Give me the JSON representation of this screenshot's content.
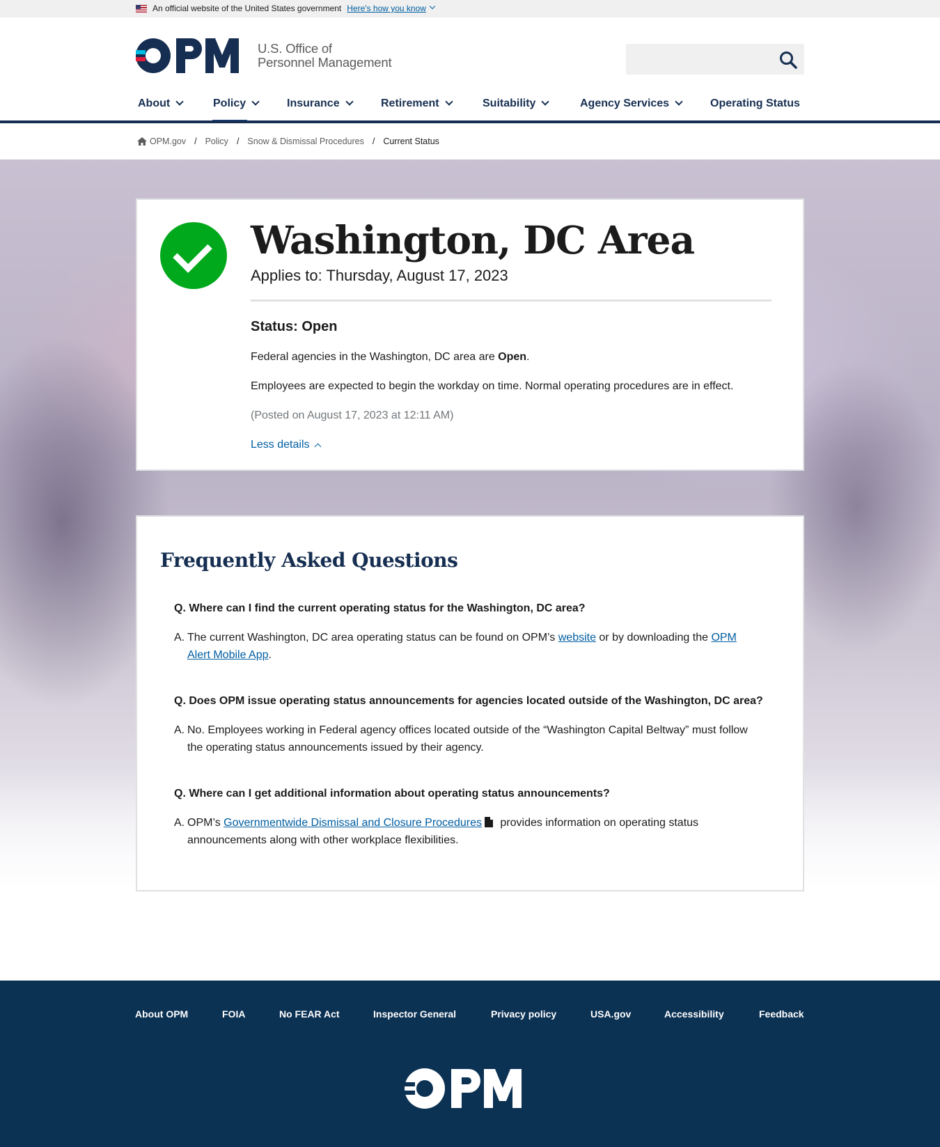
{
  "banner": {
    "text": "An official website of the United States government",
    "link": "Here's how you know"
  },
  "header": {
    "logo_text": "OPM",
    "org_line1": "U.S. Office of",
    "org_line2": "Personnel Management",
    "search_placeholder": ""
  },
  "nav": {
    "items": [
      {
        "label": "About",
        "dropdown": true
      },
      {
        "label": "Policy",
        "dropdown": true,
        "active": true
      },
      {
        "label": "Insurance",
        "dropdown": true
      },
      {
        "label": "Retirement",
        "dropdown": true
      },
      {
        "label": "Suitability",
        "dropdown": true
      },
      {
        "label": "Agency Services",
        "dropdown": true
      },
      {
        "label": "Operating Status",
        "dropdown": false
      }
    ]
  },
  "breadcrumb": [
    "OPM.gov",
    "Policy",
    "Snow & Dismissal Procedures",
    "Current Status"
  ],
  "status": {
    "title": "Washington, DC Area",
    "applies": "Applies to: Thursday, August 17, 2023",
    "label": "Status: Open",
    "line1_prefix": "Federal agencies in the Washington, DC area are ",
    "line1_bold": "Open",
    "line1_suffix": ".",
    "line2": "Employees are expected to begin the workday on time. Normal operating procedures are in effect.",
    "posted": "(Posted on August 17, 2023 at 12:11 AM)",
    "toggle": "Less details",
    "color": "#00a91c"
  },
  "faq": {
    "title": "Frequently Asked Questions",
    "q1": "Q. Where can I find the current operating status for the Washington, DC area?",
    "a1_lead": "A.",
    "a1_text1": "The current Washington, DC area operating status can be found on OPM’s ",
    "a1_link1": "website",
    "a1_text2": " or by downloading the ",
    "a1_link2": "OPM Alert Mobile App",
    "a1_text3": ".",
    "q2": "Q. Does OPM issue operating status announcements for agencies located outside of the Washington, DC area?",
    "a2_lead": "A.",
    "a2_text": "No. Employees working in Federal agency offices located outside of the “Washington Capital Beltway” must follow the operating status announcements issued by their agency.",
    "q3": "Q. Where can I get additional information about operating status announcements?",
    "a3_lead": "A.",
    "a3_text1": "OPM’s ",
    "a3_link": "Governmentwide Dismissal and Closure Procedures",
    "a3_text2": " provides information on operating status announcements along with other workplace flexibilities."
  },
  "footer": {
    "links": [
      "About OPM",
      "FOIA",
      "No FEAR Act",
      "Inspector General",
      "Privacy policy",
      "USA.gov",
      "Accessibility",
      "Feedback"
    ],
    "logo_text": "OPM"
  },
  "colors": {
    "navy": "#162e51",
    "footer": "#0b3153",
    "link": "#005ea2",
    "brand_red": "#e31c3d",
    "brand_cyan": "#00bde3"
  }
}
